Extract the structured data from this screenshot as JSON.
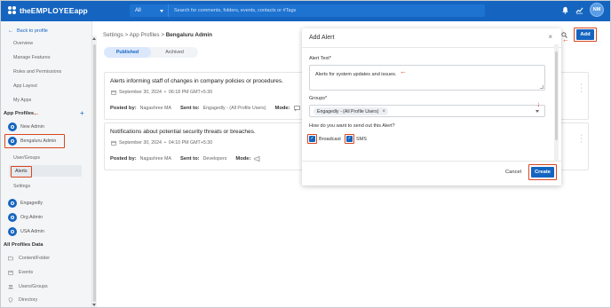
{
  "topbar": {
    "logo_the": "the",
    "logo_brand": "EMPLOYEE",
    "logo_app": "app",
    "search_scope": "All",
    "search_placeholder": "Search for comments, folders, events, contacts or #Tags",
    "avatar_initials": "NM"
  },
  "sidebar": {
    "back_label": "Back to profile",
    "menu": [
      "Overview",
      "Manage Features",
      "Roles and Permissions",
      "App Layout",
      "My Apps"
    ],
    "app_profiles_label": "App Profiles",
    "profiles": [
      "New Admin",
      "Bengaluru Admin"
    ],
    "sub_items": [
      "User/Groups",
      "Alerts",
      "Settings"
    ],
    "other_profiles": [
      "Engagedly",
      "Org Admin",
      "USA Admin"
    ],
    "all_profiles_data_label": "All Profiles Data",
    "data_items": [
      "Content/Folder",
      "Events",
      "Users/Groups",
      "Directory"
    ]
  },
  "breadcrumb": {
    "settings": "Settings",
    "sep1": ">",
    "app_profiles": "App Profiles",
    "sep2": ">",
    "current": "Bengaluru Admin"
  },
  "tabs": {
    "published": "Published",
    "archived": "Archived"
  },
  "alerts": [
    {
      "title": "Alerts informing staff of changes in company policies or procedures.",
      "date": "September 30, 2024",
      "time": "06:18 PM GMT+5:30",
      "posted_by_label": "Posted by:",
      "posted_by": "Nagashree MA",
      "sent_to_label": "Sent to:",
      "sent_to": "Engagedly - (All Profile Users)",
      "mode_label": "Mode:"
    },
    {
      "title": "Notifications about potential security threats or breaches.",
      "date": "September 30, 2024",
      "time": "04:10 PM GMT+5:30",
      "posted_by_label": "Posted by:",
      "posted_by": "Nagashree MA",
      "sent_to_label": "Sent to:",
      "sent_to": "Developers",
      "mode_label": "Mode:"
    }
  ],
  "add_button": "Add",
  "modal": {
    "title": "Add Alert",
    "close": "×",
    "alert_text_label": "Alert Text*",
    "alert_text_value": "Alerts for system updates and issues.",
    "groups_label": "Groups*",
    "group_chip": "Engagedly - (All Profile Users)",
    "chip_remove": "×",
    "send_out_label": "How do you want to send out this Alert?",
    "broadcast_label": "Broadcast",
    "sms_label": "SMS",
    "cancel": "Cancel",
    "create": "Create"
  },
  "colors": {
    "brand": "#1565c0",
    "highlight": "#d9461f"
  },
  "icons": {
    "bell": "bell-icon",
    "chart": "chart-icon",
    "calendar": "calendar-icon",
    "search": "search-icon",
    "kebab": "kebab-icon",
    "check": "check-icon"
  }
}
